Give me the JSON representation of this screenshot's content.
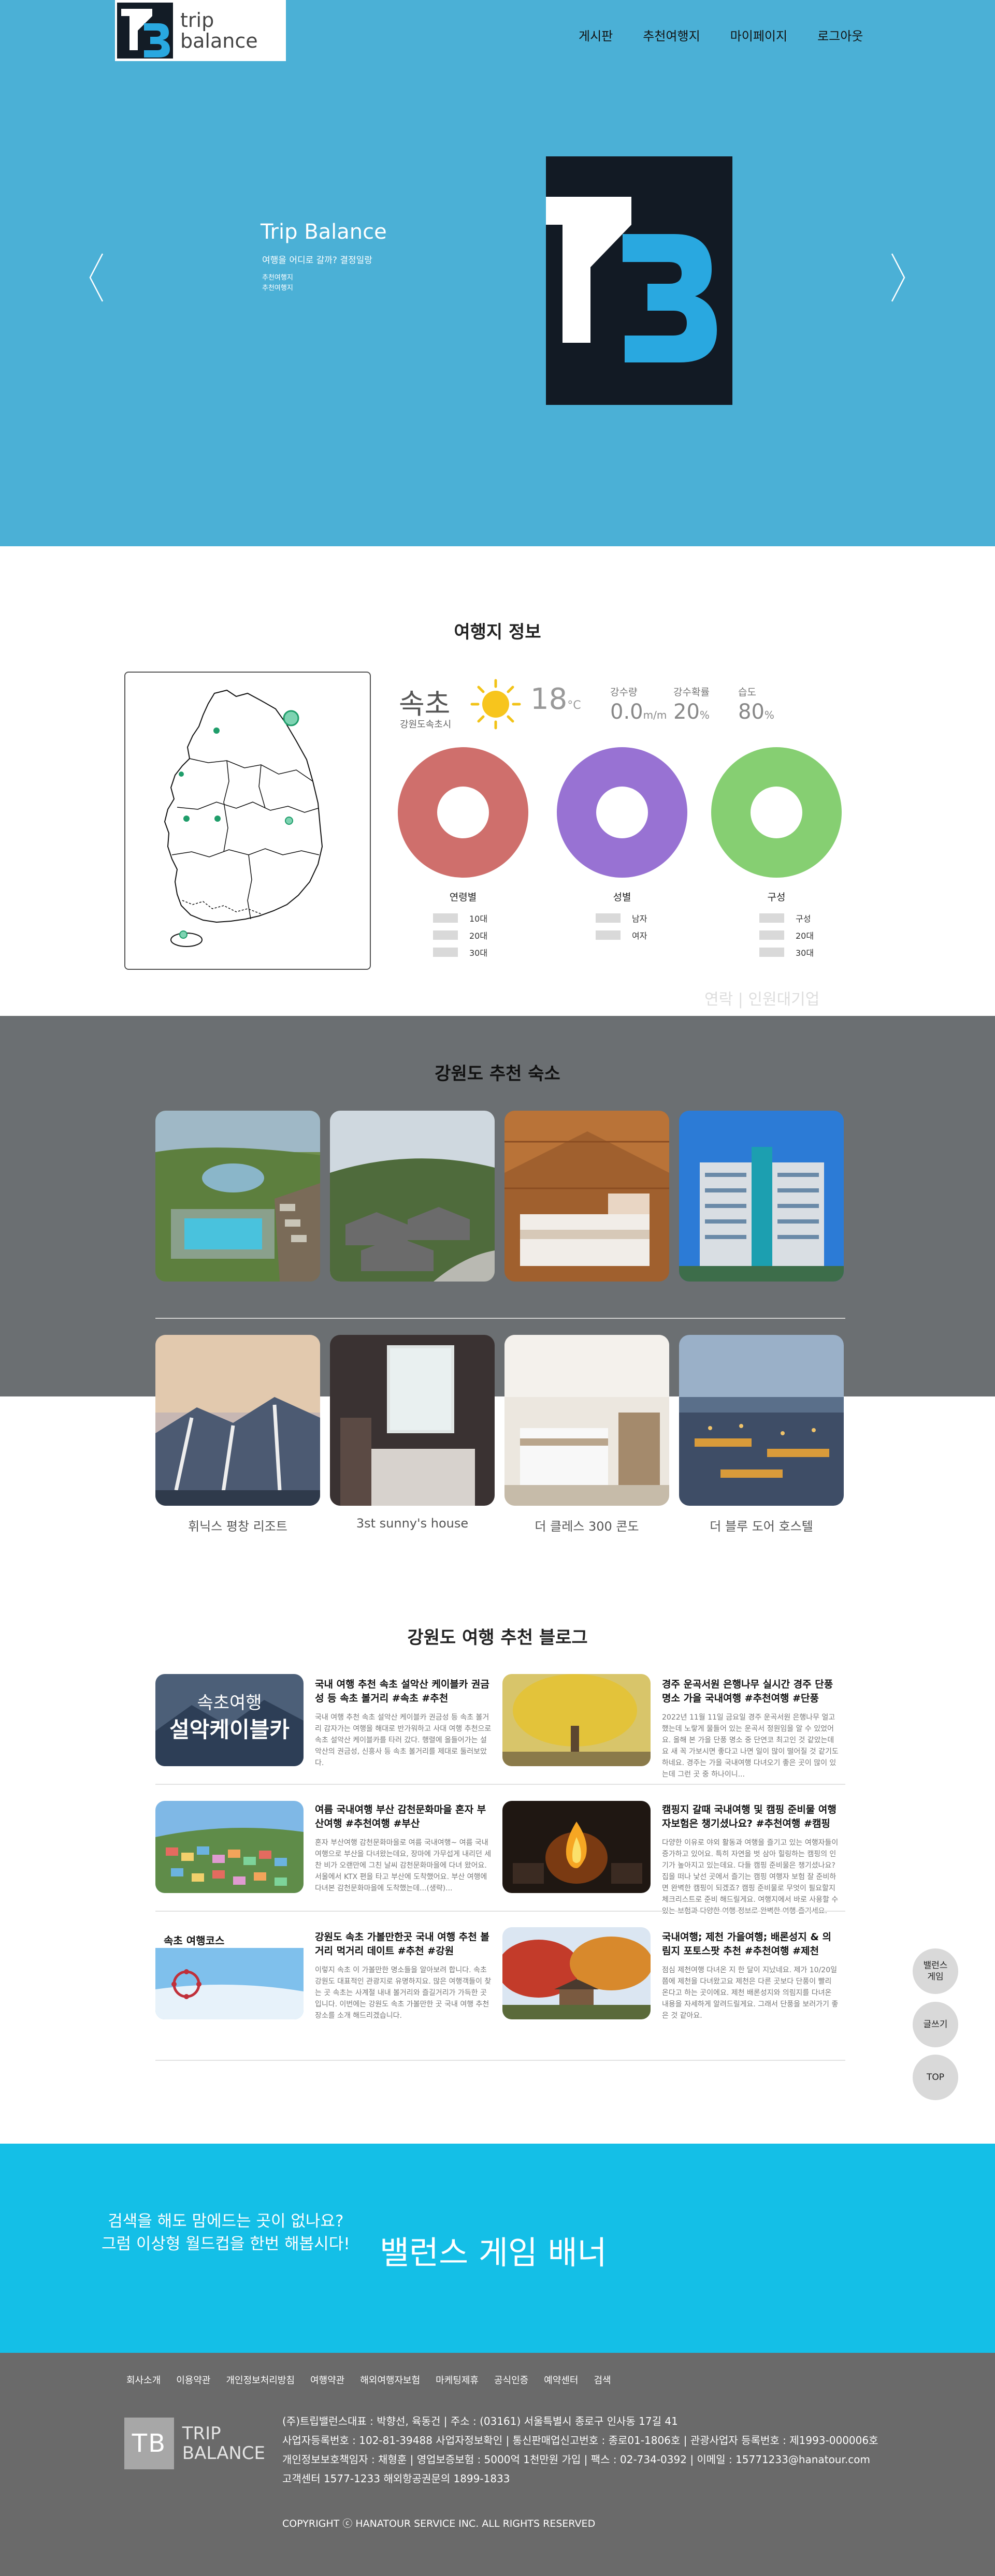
{
  "header": {
    "logo_text_line1": "trip",
    "logo_text_line2": "balance",
    "nav": [
      "게시판",
      "추천여행지",
      "마이페이지",
      "로그아웃"
    ]
  },
  "hero": {
    "title": "Trip Balance",
    "subtitle": "여행을 어디로 갈까? 결정일랑",
    "links": [
      "추천여행지",
      "추천여행지"
    ]
  },
  "travel_info": {
    "title": "여행지 정보",
    "city": "속초",
    "region": "강원도속초시",
    "temperature": "18",
    "temperature_unit": "°C",
    "precip_label": "강수량",
    "precip_value": "0.0",
    "precip_unit": "m/m",
    "precip_prob_label": "강수확률",
    "precip_prob_value": "20",
    "precip_prob_unit": "%",
    "humidity_label": "습도",
    "humidity_value": "80",
    "humidity_unit": "%",
    "charts": [
      {
        "label": "연령별",
        "color": "#cf6f6c",
        "legend": [
          "10대",
          "20대",
          "30대"
        ]
      },
      {
        "label": "성별",
        "color": "#9872d3",
        "legend": [
          "남자",
          "여자"
        ]
      },
      {
        "label": "구성",
        "color": "#86cf72",
        "legend": [
          "구성",
          "20대",
          "30대"
        ]
      }
    ],
    "ghost_text": "연락 | 인원대기업"
  },
  "accommodation": {
    "title": "강원도 추천 숙소",
    "items": [
      {
        "name": ""
      },
      {
        "name": ""
      },
      {
        "name": ""
      },
      {
        "name": ""
      },
      {
        "name": "휘닉스 평창 리조트"
      },
      {
        "name": "3st sunny's house"
      },
      {
        "name": "더 클레스 300 콘도"
      },
      {
        "name": "더 블루 도어 호스텔"
      }
    ]
  },
  "blog": {
    "title": "강원도 여행 추천 블로그",
    "posts": [
      {
        "title": "국내 여행 추천 속초 설악산 케이블카 권금성 등 속초 볼거리 #속초 #추천",
        "body": "국내 여행 추천 속초 설악산 케이블카 권금성 등 속초 볼거리 감자가는 여행을 해대로 반가워하고 사대 여행 추천으로 속초 설악산 케이블카를 타러 갔다. 행렬에 올들어가는 설악산의 권금성, 신흥사 등 속초 볼거리를 제대로 둘러보았다.",
        "thumb_caption1": "속초여행",
        "thumb_caption2": "설악케이블카"
      },
      {
        "title": "경주 운곡서원 은행나무 실시간 경주 단풍 명소 가을 국내여행 #추천여행 #단풍",
        "body": "2022년 11월 11일 금요일 경주 운곡서원 은행나무 얼고 했는데 노랗게 물들어 있는 운곡서 정원임을 알 수 있었어요. 올해 본 가을 단풍 명소 중 단연코 최고인 것 같았는데요 새 꼭 가보시면 좋다고 나면 일이 많이 떨어질 것 같기도 하네요. 경주는 가을 국내여행 다녀오기 좋은 곳이 많이 있는데 그런 곳 중 하나이니..."
      },
      {
        "title": "여름 국내여행 부산 감천문화마을 혼자 부산여행 #추천여행 #부산",
        "body": "혼자 부산여행 감천문화마을로 여름 국내여행~ 여름 국내여행으로 부산을 다녀왔는데요, 장마에 가무섭게 내리던 세찬 비가 오랜만에 그친 날씨 감천문화마을에 다녀 왔어요. 서울에서 KTX 편을 타고 부산에 도착했어요. 부산 여행에 다녀본 감천문화마을에 도착했는데...(생략)..."
      },
      {
        "title": "캠핑지 갈때 국내여행 및 캠핑 준비물 여행자보험은 챙기셨나요? #추천여행 #캠핑",
        "body": "다양한 이유로 야외 활동과 여행을 즐기고 있는 여행자들이 증가하고 있어요. 특히 자연을 벗 삼아 힐링하는 캠핑의 인기가 높아지고 있는데요. 다들 캠핑 준비물은 챙기셨나요? 집을 떠나 낯선 곳에서 즐기는 캠핑 여행자 보험 잘 준비하면 완벽한 캠핑이 되겠죠? 캠핑 준비물로 무엇이 필요할지 체크리스트로 준비 해드릴게요. 여행지에서 바로 사용할 수 있는 보험과 다양한 여행 정보로 완벽한 여행 즐기세요."
      },
      {
        "title": "강원도 속초 가볼만한곳 국내 여행 추천 볼거리 먹거리 데이트 #추천 #강원",
        "body": "이렇지 속초 이 가볼만한 명소들을 알아보려 합니다. 속초 강원도 대표적인 관광지로 유명하지요. 많은 여행객들이 찾는 곳 속초는 사계절 내내 볼거리와 즐길거리가 가득한 곳입니다. 이번에는 강원도 속초 가볼만한 곳 국내 여행 추천 장소를 소개 해드리겠습니다.",
        "thumb_caption1": "속초 여행코스"
      },
      {
        "title": "국내여행; 제천 가을여행; 배론성지 & 의림지 포토스팟 추천 #추천여행 #제천",
        "body": "점심 제천여행 다녀온 지 한 달이 지났네요. 제가 10/20일쯤에 제천을 다녀왔고요 제천은 다른 곳보다 단풍이 빨리 온다고 하는 곳이에요. 제천 배론성지와 의림지를 다녀온 내용을 자세하게 알려드릴게요. 그래서 단풍을 보러가기 좋은 것 같아요."
      }
    ]
  },
  "floating_buttons": [
    {
      "line1": "밸런스",
      "line2": "게임"
    },
    {
      "line1": "글쓰기",
      "line2": ""
    },
    {
      "line1": "TOP",
      "line2": ""
    }
  ],
  "banner": {
    "sub_line1": "검색을 해도 맘에드는 곳이 없나요?",
    "sub_line2": "그럼 이상형 월드컵을 한번 해봅시다!",
    "title": "밸런스 게임 배너"
  },
  "footer": {
    "nav": [
      "회사소개",
      "이용약관",
      "개인정보처리방침",
      "여행약관",
      "해외여행자보험",
      "마케팅제휴",
      "공식인증",
      "예약센터",
      "검색"
    ],
    "logo_mark": "TB",
    "logo_line1": "TRIP",
    "logo_line2": "BALANCE",
    "info_lines": [
      "(주)트립밸런스대표 : 박향선, 육동건 | 주소 : (03161) 서울특별시 종로구 인사동 17길 41",
      "사업자등록번호 : 102-81-39488 사업자정보확인 | 통신판매업신고번호 : 종로01-1806호 | 관광사업자 등록번호 : 제1993-000006호",
      "개인정보보호책임자 : 채형훈 | 영업보증보험 : 5000억 1천만원 가입 | 팩스 : 02-734-0392 | 이메일 : 15771233@hanatour.com",
      "고객센터 1577-1233    해외항공권문의 1899-1833"
    ],
    "copyright": "COPYRIGHT ⓒ HANATOUR SERVICE INC. ALL RIGHTS RESERVED"
  }
}
